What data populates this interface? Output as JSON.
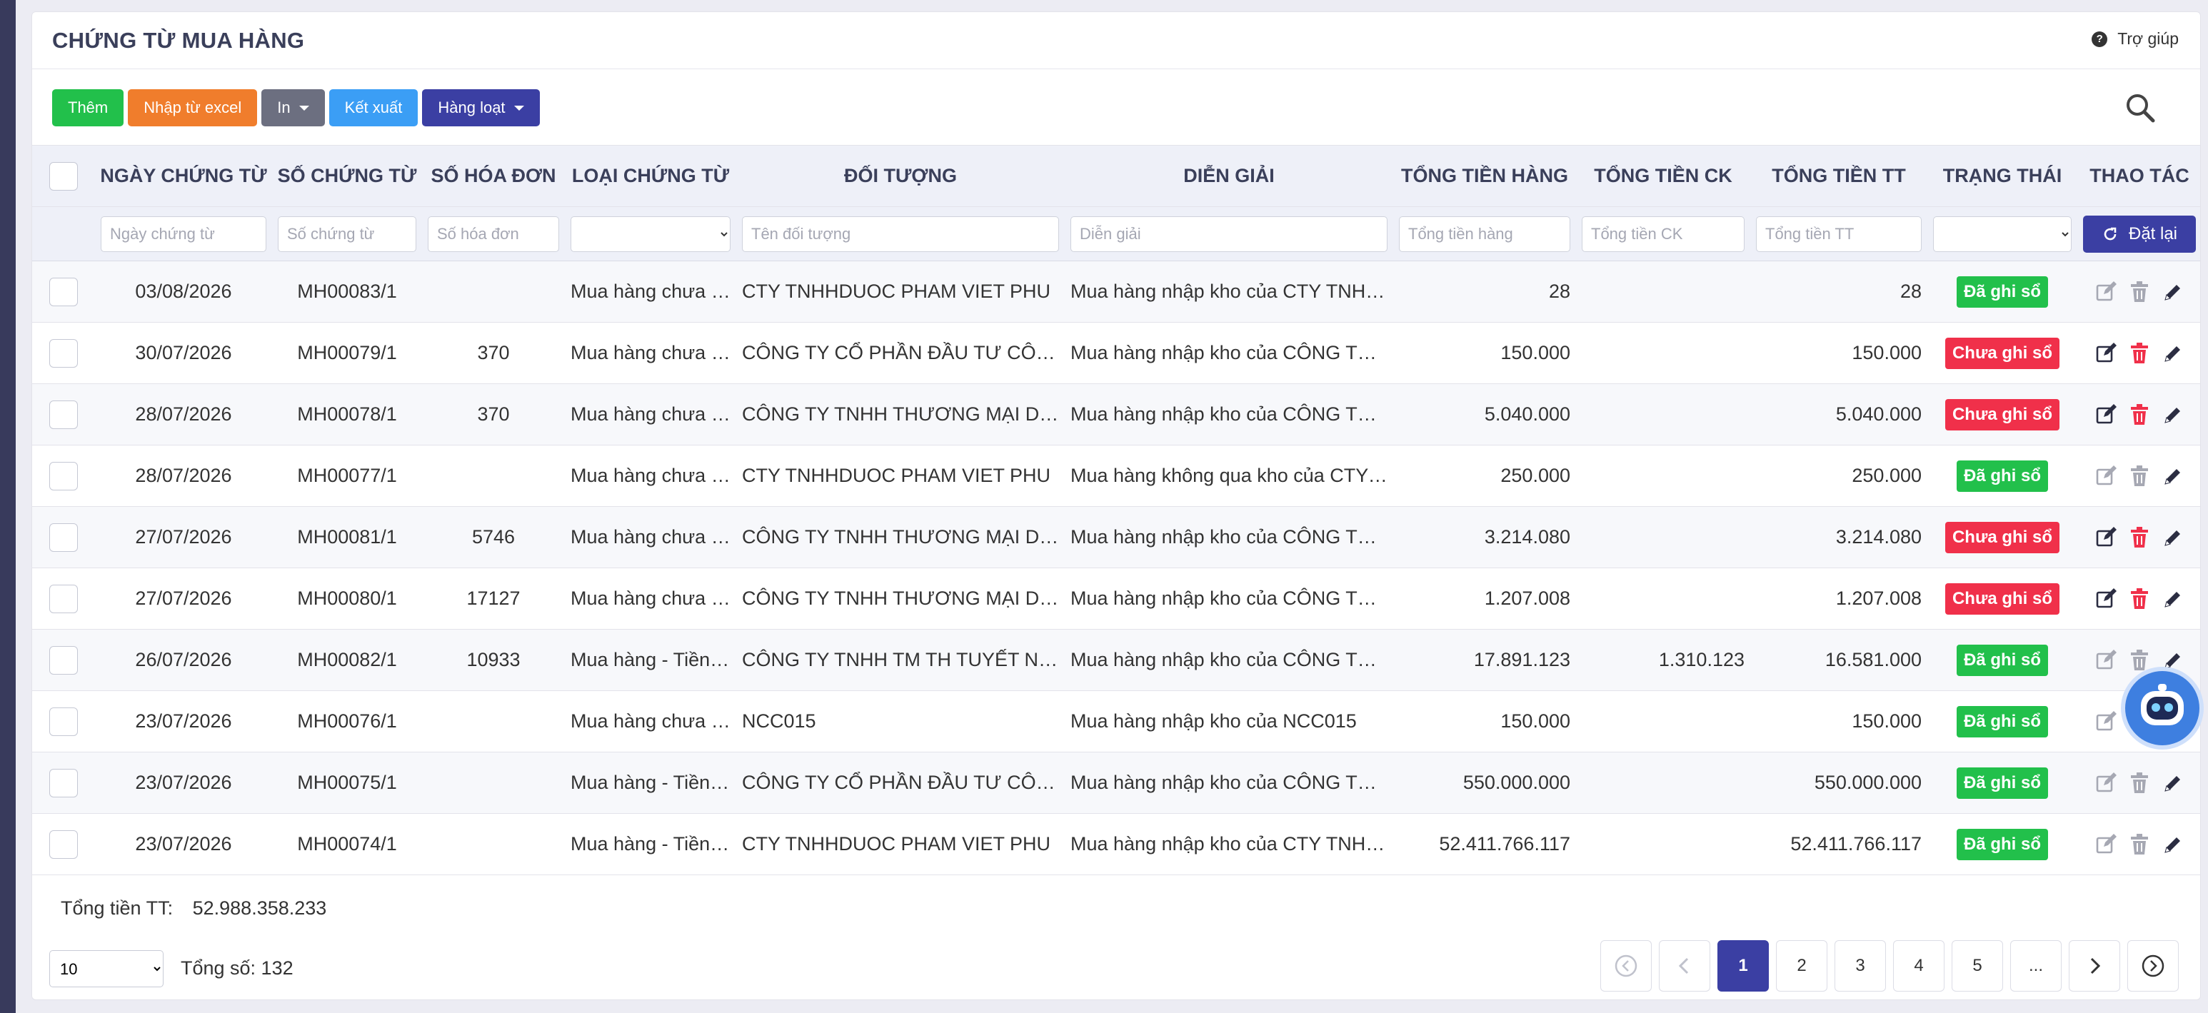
{
  "page": {
    "title": "CHỨNG TỪ MUA HÀNG",
    "help_label": "Trợ giúp"
  },
  "toolbar": {
    "add_label": "Thêm",
    "import_label": "Nhập từ excel",
    "print_label": "In",
    "export_label": "Kết xuất",
    "batch_label": "Hàng loạt"
  },
  "colors": {
    "add": "#22c04b",
    "import": "#f07d2c",
    "print": "#6c6f80",
    "export": "#3b9ef5",
    "batch": "#3b3fa3",
    "posted": "#22c04b",
    "unposted": "#f0304a",
    "edit_active": "#2b2d42",
    "delete_active": "#f0304a",
    "disabled_icon": "#a6a8b3"
  },
  "columns": {
    "date": "NGÀY CHỨNG TỪ",
    "voucher_no": "SỐ CHỨNG TỪ",
    "invoice_no": "SỐ HÓA ĐƠN",
    "voucher_type": "LOẠI CHỨNG TỪ",
    "partner": "ĐỐI TƯỢNG",
    "description": "DIỄN GIẢI",
    "goods_total": "TỔNG TIỀN HÀNG",
    "discount_total": "TỔNG TIỀN CK",
    "pay_total": "TỔNG TIỀN TT",
    "status": "TRẠNG THÁI",
    "actions": "THAO TÁC"
  },
  "filters": {
    "date_placeholder": "Ngày chứng từ",
    "voucher_no_placeholder": "Số chứng từ",
    "invoice_no_placeholder": "Số hóa đơn",
    "partner_placeholder": "Tên đối tượng",
    "description_placeholder": "Diễn giải",
    "goods_total_placeholder": "Tổng tiền hàng",
    "discount_total_placeholder": "Tổng tiền CK",
    "pay_total_placeholder": "Tổng tiền TT",
    "reset_label": "Đặt lại"
  },
  "rows": [
    {
      "date": "03/08/2026",
      "voucher_no": "MH00083/1",
      "invoice_no": "",
      "voucher_type": "Mua hàng chưa thanh toán",
      "partner": "CTY TNHHDUOC PHAM VIET PHU",
      "description": "Mua hàng nhập kho của CTY TNHHDUOC PHAM VIET PHU",
      "goods_total": "28",
      "discount_total": "",
      "pay_total": "28",
      "status": "Đã ghi sổ",
      "posted": true
    },
    {
      "date": "30/07/2026",
      "voucher_no": "MH00079/1",
      "invoice_no": "370",
      "voucher_type": "Mua hàng chưa thanh toán",
      "partner": "CÔNG TY CỔ PHẦN ĐẦU TƯ CÔNG NGHỆ",
      "description": "Mua hàng nhập kho của CÔNG TY CỔ PHẦN ĐẦU TƯ",
      "goods_total": "150.000",
      "discount_total": "",
      "pay_total": "150.000",
      "status": "Chưa ghi sổ",
      "posted": false
    },
    {
      "date": "28/07/2026",
      "voucher_no": "MH00078/1",
      "invoice_no": "370",
      "voucher_type": "Mua hàng chưa thanh toán",
      "partner": "CÔNG TY TNHH THƯƠNG MẠI DỊCH VỤ",
      "description": "Mua hàng nhập kho của CÔNG TY TNHH THƯƠNG MẠI",
      "goods_total": "5.040.000",
      "discount_total": "",
      "pay_total": "5.040.000",
      "status": "Chưa ghi sổ",
      "posted": false
    },
    {
      "date": "28/07/2026",
      "voucher_no": "MH00077/1",
      "invoice_no": "",
      "voucher_type": "Mua hàng chưa thanh toán",
      "partner": "CTY TNHHDUOC PHAM VIET PHU",
      "description": "Mua hàng không qua kho của CTY TNHHDUOC PHAM",
      "goods_total": "250.000",
      "discount_total": "",
      "pay_total": "250.000",
      "status": "Đã ghi sổ",
      "posted": true
    },
    {
      "date": "27/07/2026",
      "voucher_no": "MH00081/1",
      "invoice_no": "5746",
      "voucher_type": "Mua hàng chưa thanh toán",
      "partner": "CÔNG TY TNHH THƯƠNG MẠI DỊCH VỤ",
      "description": "Mua hàng nhập kho của CÔNG TY TNHH THƯƠNG MẠI",
      "goods_total": "3.214.080",
      "discount_total": "",
      "pay_total": "3.214.080",
      "status": "Chưa ghi sổ",
      "posted": false
    },
    {
      "date": "27/07/2026",
      "voucher_no": "MH00080/1",
      "invoice_no": "17127",
      "voucher_type": "Mua hàng chưa thanh toán",
      "partner": "CÔNG TY TNHH THƯƠNG MẠI DỊCH VỤ",
      "description": "Mua hàng nhập kho của CÔNG TY TNHH THƯƠNG MẠI",
      "goods_total": "1.207.008",
      "discount_total": "",
      "pay_total": "1.207.008",
      "status": "Chưa ghi sổ",
      "posted": false
    },
    {
      "date": "26/07/2026",
      "voucher_no": "MH00082/1",
      "invoice_no": "10933",
      "voucher_type": "Mua hàng - Tiền mặt",
      "partner": "CÔNG TY TNHH TM TH TUYẾT NGA",
      "description": "Mua hàng nhập kho của CÔNG TY TNHH TM TH TUYẾT",
      "goods_total": "17.891.123",
      "discount_total": "1.310.123",
      "pay_total": "16.581.000",
      "status": "Đã ghi sổ",
      "posted": true
    },
    {
      "date": "23/07/2026",
      "voucher_no": "MH00076/1",
      "invoice_no": "",
      "voucher_type": "Mua hàng chưa thanh toán",
      "partner": "NCC015",
      "description": "Mua hàng nhập kho của NCC015",
      "goods_total": "150.000",
      "discount_total": "",
      "pay_total": "150.000",
      "status": "Đã ghi sổ",
      "posted": true
    },
    {
      "date": "23/07/2026",
      "voucher_no": "MH00075/1",
      "invoice_no": "",
      "voucher_type": "Mua hàng - Tiền mặt",
      "partner": "CÔNG TY CỔ PHẦN ĐẦU TƯ CÔNG NGHỆ",
      "description": "Mua hàng nhập kho của CÔNG TY CỔ PHẦN ĐẦU TƯ",
      "goods_total": "550.000.000",
      "discount_total": "",
      "pay_total": "550.000.000",
      "status": "Đã ghi sổ",
      "posted": true
    },
    {
      "date": "23/07/2026",
      "voucher_no": "MH00074/1",
      "invoice_no": "",
      "voucher_type": "Mua hàng - Tiền mặt",
      "partner": "CTY TNHHDUOC PHAM VIET PHU",
      "description": "Mua hàng nhập kho của CTY TNHHDUOC PHAM VIET PHU",
      "goods_total": "52.411.766.117",
      "discount_total": "",
      "pay_total": "52.411.766.117",
      "status": "Đã ghi sổ",
      "posted": true
    }
  ],
  "footer": {
    "total_label": "Tổng tiền TT:",
    "total_value": "52.988.358.233",
    "page_size": "10",
    "count_text": "Tổng số: 132"
  },
  "pagination": {
    "pages": [
      "1",
      "2",
      "3",
      "4",
      "5",
      "..."
    ],
    "current": "1"
  },
  "icons": {
    "help": "help-circle-icon",
    "search": "search-icon",
    "reset": "refresh-icon",
    "edit": "edit-square-icon",
    "delete": "trash-icon",
    "pencil": "pencil-icon",
    "first": "first-page-icon",
    "prev": "chevron-left-icon",
    "next": "chevron-right-icon",
    "last": "last-page-icon",
    "assistant": "robot-assistant-icon"
  }
}
